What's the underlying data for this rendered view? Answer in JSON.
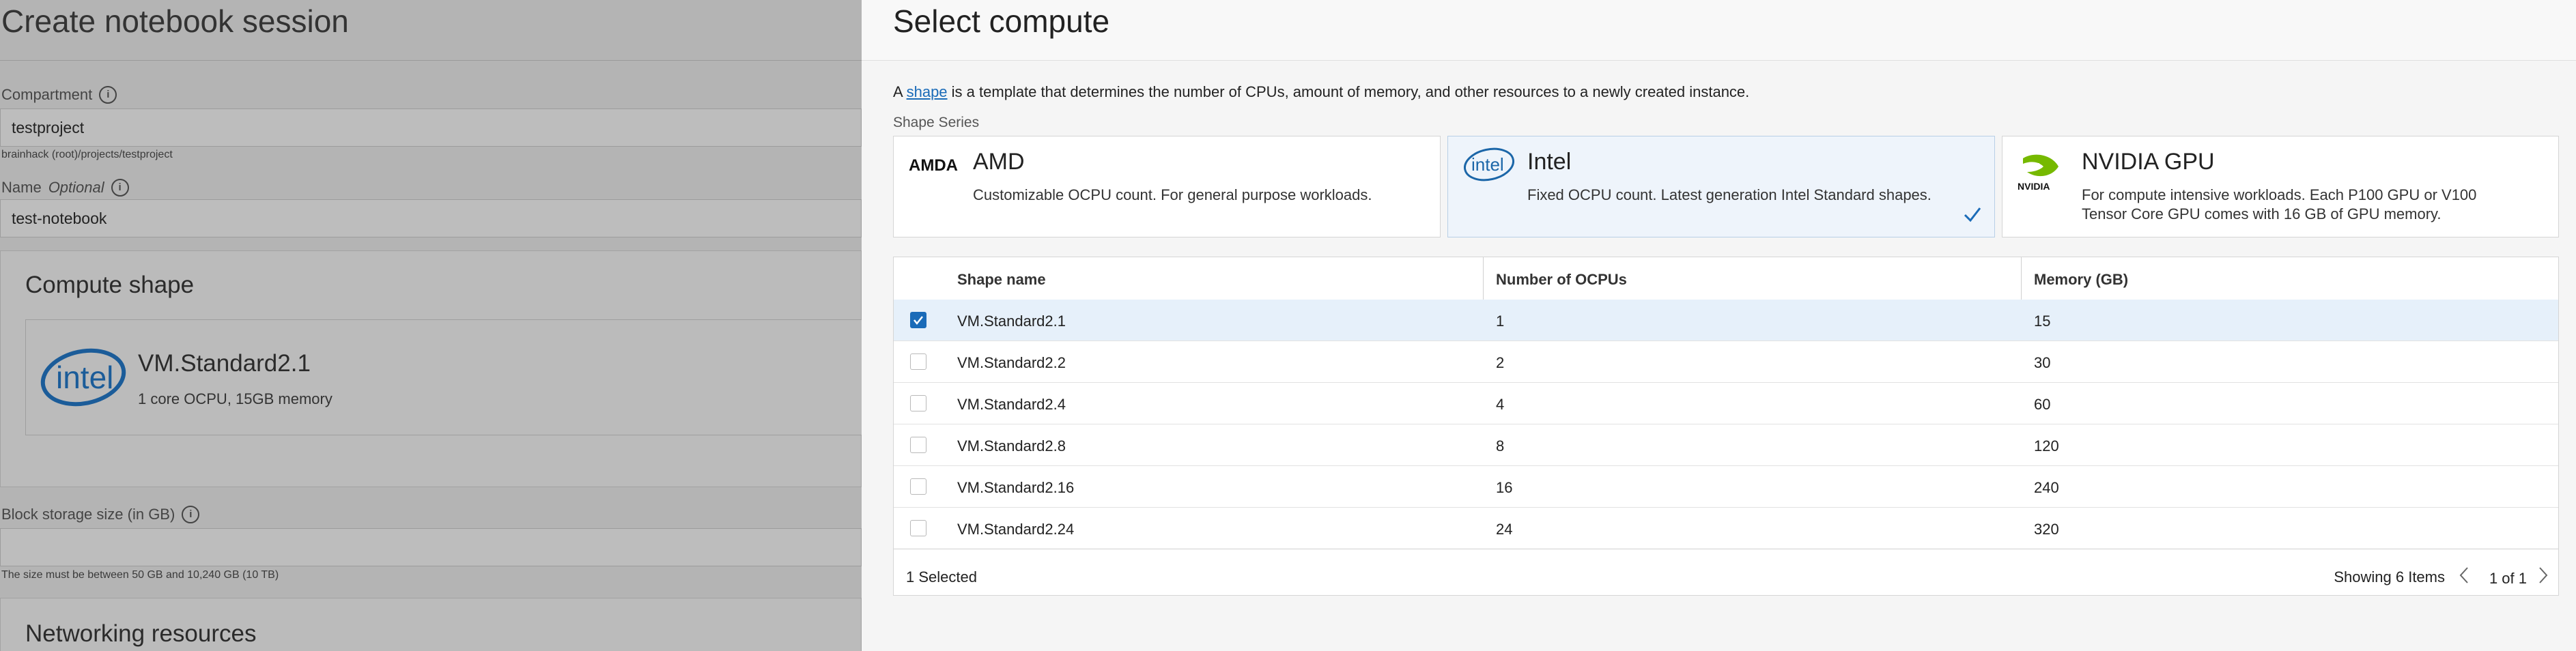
{
  "left_form": {
    "title": "Create notebook session",
    "compartment": {
      "label": "Compartment",
      "value": "testproject",
      "path": "brainhack (root)/projects/testproject"
    },
    "name": {
      "label": "Name",
      "optional": "Optional",
      "value": "test-notebook"
    },
    "compute_shape": {
      "section_title": "Compute shape",
      "shape_name": "VM.Standard2.1",
      "shape_desc": "1 core OCPU, 15GB memory",
      "logo_text": "intel"
    },
    "block_storage": {
      "label": "Block storage size (in GB)",
      "value": "",
      "help": "The size must be between 50 GB and 10,240 GB (10 TB)"
    },
    "networking": {
      "section_title": "Networking resources"
    }
  },
  "compute_panel": {
    "title": "Select compute",
    "intro_prefix": "A",
    "intro_link": "shape",
    "intro_suffix": "is a template that determines the number of CPUs, amount of memory, and other resources to a newly created instance.",
    "series_label": "Shape Series",
    "series": [
      {
        "name": "AMD",
        "logo_text": "AMDA",
        "desc": "Customizable OCPU count. For general purpose workloads.",
        "selected": false
      },
      {
        "name": "Intel",
        "logo_text": "intel",
        "desc": "Fixed OCPU count. Latest generation Intel Standard shapes.",
        "selected": true
      },
      {
        "name": "NVIDIA GPU",
        "logo_text": "NVIDIA",
        "desc": "For compute intensive workloads. Each P100 GPU or V100 Tensor Core GPU comes with 16 GB of GPU memory.",
        "selected": false
      }
    ],
    "table": {
      "columns": [
        "Shape name",
        "Number of OCPUs",
        "Memory (GB)"
      ],
      "rows": [
        {
          "name": "VM.Standard2.1",
          "ocpus": "1",
          "memory": "15",
          "checked": true
        },
        {
          "name": "VM.Standard2.2",
          "ocpus": "2",
          "memory": "30",
          "checked": false
        },
        {
          "name": "VM.Standard2.4",
          "ocpus": "4",
          "memory": "60",
          "checked": false
        },
        {
          "name": "VM.Standard2.8",
          "ocpus": "8",
          "memory": "120",
          "checked": false
        },
        {
          "name": "VM.Standard2.16",
          "ocpus": "16",
          "memory": "240",
          "checked": false
        },
        {
          "name": "VM.Standard2.24",
          "ocpus": "24",
          "memory": "320",
          "checked": false
        }
      ],
      "footer": {
        "selected_count": "1 Selected",
        "showing": "Showing 6 Items",
        "page": "1 of 1"
      }
    },
    "colors": {
      "accent": "#1a6bb8",
      "selected_row": "#e6f0fa",
      "selected_card": "#eef4fb",
      "overlay_dim": "#b4b4b4"
    }
  }
}
